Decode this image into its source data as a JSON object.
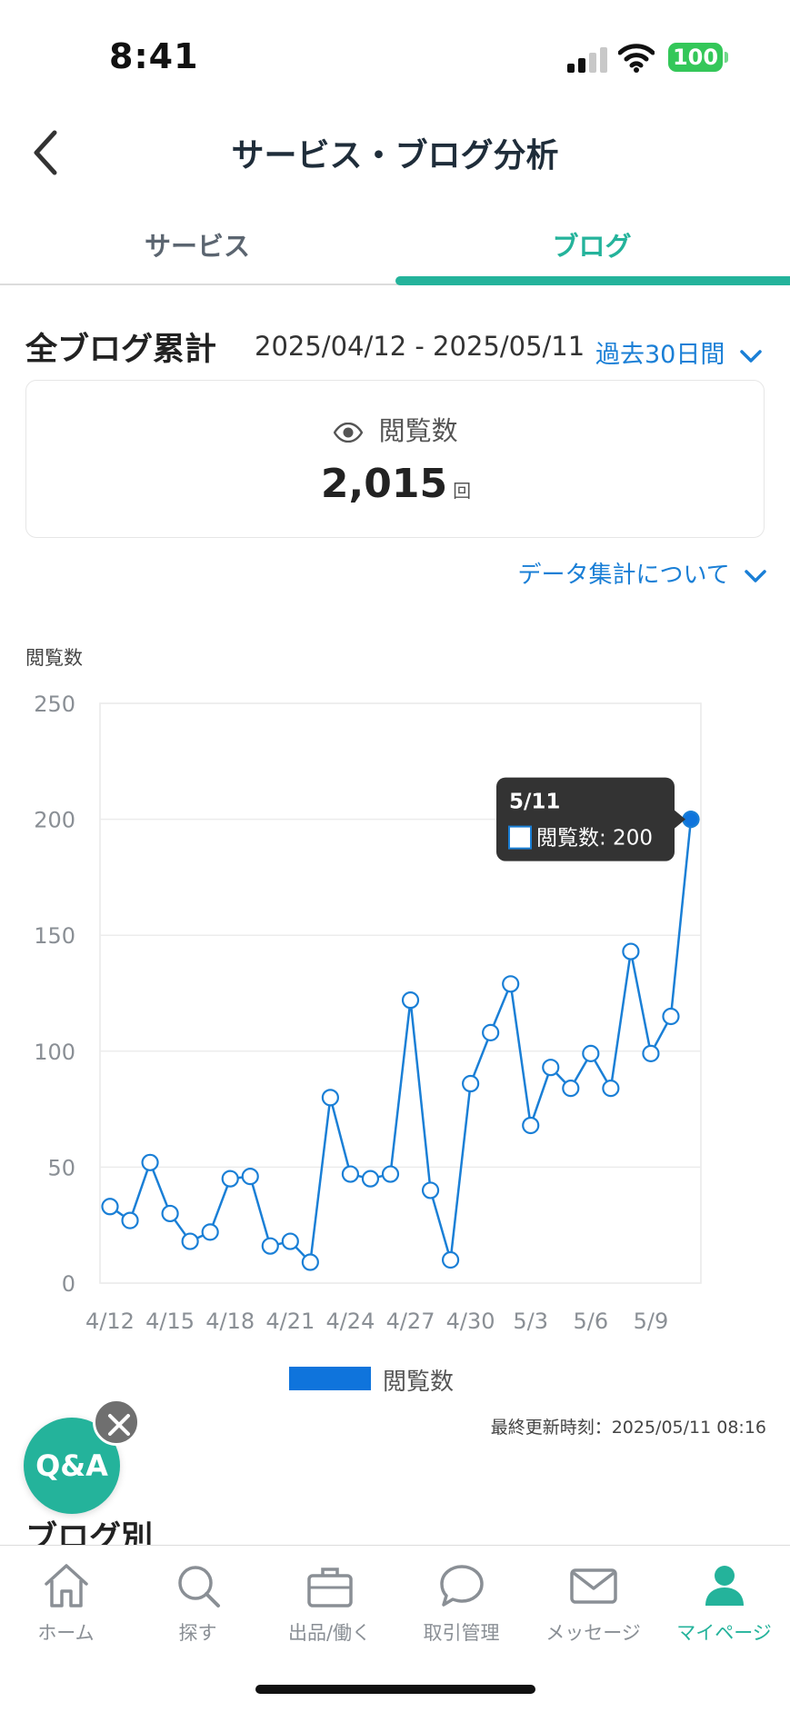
{
  "status_bar": {
    "time": "8:41",
    "battery": "100"
  },
  "header": {
    "title": "サービス・ブログ分析"
  },
  "tabs": [
    {
      "label": "サービス",
      "active": false
    },
    {
      "label": "ブログ",
      "active": true
    }
  ],
  "summary": {
    "title": "全ブログ累計",
    "date_range": "2025/04/12 - 2025/05/11",
    "period": "過去30日間",
    "stat_label": "閲覧数",
    "stat_value": "2,015",
    "stat_unit": "回",
    "data_note": "データ集計について"
  },
  "chart_data": {
    "type": "line",
    "ylabel": "閲覧数",
    "ylim": [
      0,
      250
    ],
    "yticks": [
      0,
      50,
      100,
      150,
      200,
      250
    ],
    "x": [
      "4/12",
      "4/13",
      "4/14",
      "4/15",
      "4/16",
      "4/17",
      "4/18",
      "4/19",
      "4/20",
      "4/21",
      "4/22",
      "4/23",
      "4/24",
      "4/25",
      "4/26",
      "4/27",
      "4/28",
      "4/29",
      "4/30",
      "5/1",
      "5/2",
      "5/3",
      "5/4",
      "5/5",
      "5/6",
      "5/7",
      "5/8",
      "5/9",
      "5/10",
      "5/11"
    ],
    "xtick_labels": [
      "4/12",
      "4/15",
      "4/18",
      "4/21",
      "4/24",
      "4/27",
      "4/30",
      "5/3",
      "5/6",
      "5/9"
    ],
    "series": [
      {
        "name": "閲覧数",
        "values": [
          33,
          27,
          52,
          30,
          18,
          22,
          45,
          46,
          16,
          18,
          9,
          80,
          47,
          45,
          47,
          122,
          40,
          10,
          86,
          108,
          129,
          68,
          93,
          84,
          99,
          84,
          143,
          99,
          115,
          200
        ]
      }
    ],
    "grid": true,
    "legend": "bottom",
    "colors": {
      "line": "#1a7fd6",
      "highlight": "#0f74dc"
    },
    "tooltip": {
      "date": "5/11",
      "label": "閲覧数: 200"
    }
  },
  "footer": {
    "last_updated": "最終更新時刻：2025/05/11 08:16"
  },
  "qa": {
    "label": "Q&A"
  },
  "section": {
    "title": "ブログ別"
  },
  "bottom_nav": [
    {
      "label": "ホーム",
      "icon": "home-icon"
    },
    {
      "label": "探す",
      "icon": "search-icon"
    },
    {
      "label": "出品/働く",
      "icon": "briefcase-icon"
    },
    {
      "label": "取引管理",
      "icon": "chat-bubble-icon"
    },
    {
      "label": "メッセージ",
      "icon": "mail-icon"
    },
    {
      "label": "マイページ",
      "icon": "person-icon",
      "active": true
    }
  ],
  "theme": {
    "accent": "#24b39b",
    "link": "#1a7fd6"
  }
}
